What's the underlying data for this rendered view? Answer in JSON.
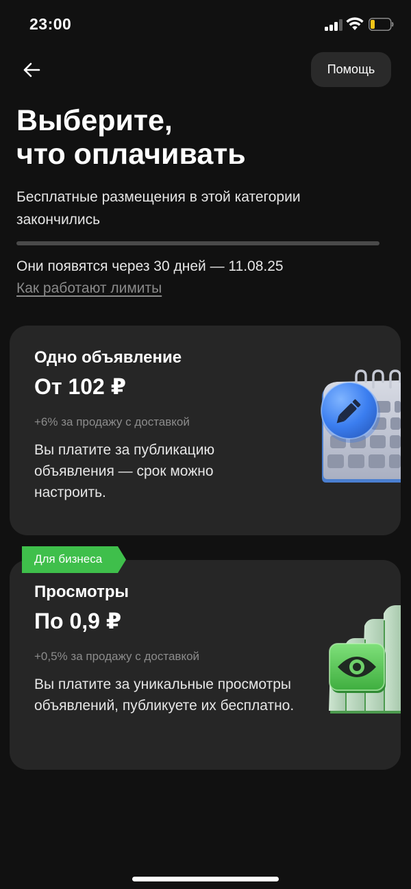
{
  "status_bar": {
    "time": "23:00",
    "icons": [
      "cellular-signal-icon",
      "wifi-icon",
      "battery-icon"
    ]
  },
  "header": {
    "back_icon": "arrow-left-icon",
    "help_label": "Помощь"
  },
  "title": {
    "line1": "Выберите,",
    "line2": "что оплачивать"
  },
  "subtitle": "Бесплатные размещения в этой категории закончились",
  "limit": {
    "info": "Они появятся через 30 дней — 11.08.25",
    "link": "Как работают лимиты"
  },
  "cards": [
    {
      "title": "Одно объявление",
      "price": "От 102 ₽",
      "fee": "+6% за продажу с доставкой",
      "description": "Вы платите за публикацию объявления — срок можно настроить.",
      "illustration": "calendar-pencil-icon"
    },
    {
      "badge": "Для бизнеса",
      "title": "Просмотры",
      "price": "По 0,9 ₽",
      "fee": "+0,5% за продажу с доставкой",
      "description": "Вы платите за уникальные просмотры объявлений, публикуете их бесплатно.",
      "illustration": "bar-chart-eye-icon"
    }
  ],
  "colors": {
    "background": "#111111",
    "card": "#262626",
    "badge_green": "#3fbf4b",
    "help_button": "#2a2a2a",
    "muted_text": "#8c8c8c",
    "battery_low": "#f5c518"
  }
}
